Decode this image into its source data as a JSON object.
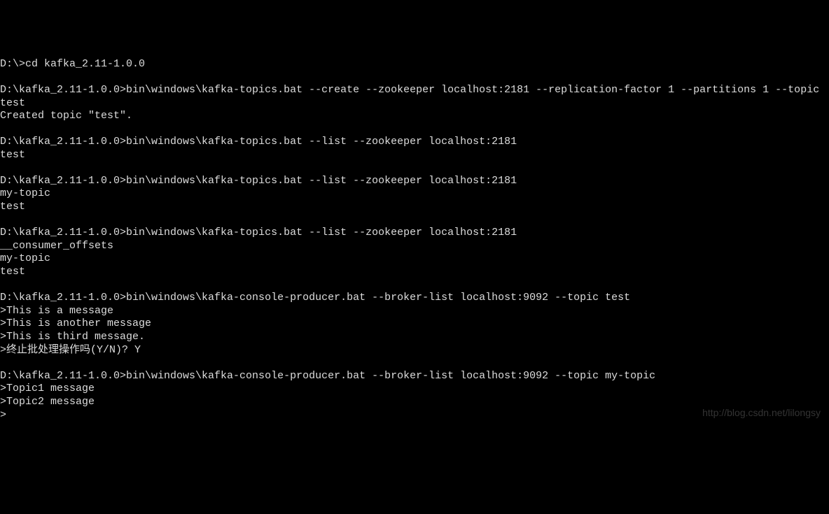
{
  "terminal": {
    "blocks": [
      {
        "prompt": "D:\\>",
        "command": "cd kafka_2.11-1.0.0",
        "outputs": []
      },
      {
        "prompt": "D:\\kafka_2.11-1.0.0>",
        "command": "bin\\windows\\kafka-topics.bat --create --zookeeper localhost:2181 --replication-factor 1 --partitions 1 --topic test",
        "outputs": [
          "Created topic \"test\"."
        ]
      },
      {
        "prompt": "D:\\kafka_2.11-1.0.0>",
        "command": "bin\\windows\\kafka-topics.bat --list --zookeeper localhost:2181",
        "outputs": [
          "test"
        ]
      },
      {
        "prompt": "D:\\kafka_2.11-1.0.0>",
        "command": "bin\\windows\\kafka-topics.bat --list --zookeeper localhost:2181",
        "outputs": [
          "my-topic",
          "test"
        ]
      },
      {
        "prompt": "D:\\kafka_2.11-1.0.0>",
        "command": "bin\\windows\\kafka-topics.bat --list --zookeeper localhost:2181",
        "outputs": [
          "__consumer_offsets",
          "my-topic",
          "test"
        ]
      },
      {
        "prompt": "D:\\kafka_2.11-1.0.0>",
        "command": "bin\\windows\\kafka-console-producer.bat --broker-list localhost:9092 --topic test",
        "outputs": [
          ">This is a message",
          ">This is another message",
          ">This is third message.",
          ">终止批处理操作吗(Y/N)? Y"
        ]
      },
      {
        "prompt": "D:\\kafka_2.11-1.0.0>",
        "command": "bin\\windows\\kafka-console-producer.bat --broker-list localhost:9092 --topic my-topic",
        "outputs": [
          ">Topic1 message",
          ">Topic2 message",
          ">"
        ]
      }
    ]
  },
  "watermark": "http://blog.csdn.net/lilongsy"
}
